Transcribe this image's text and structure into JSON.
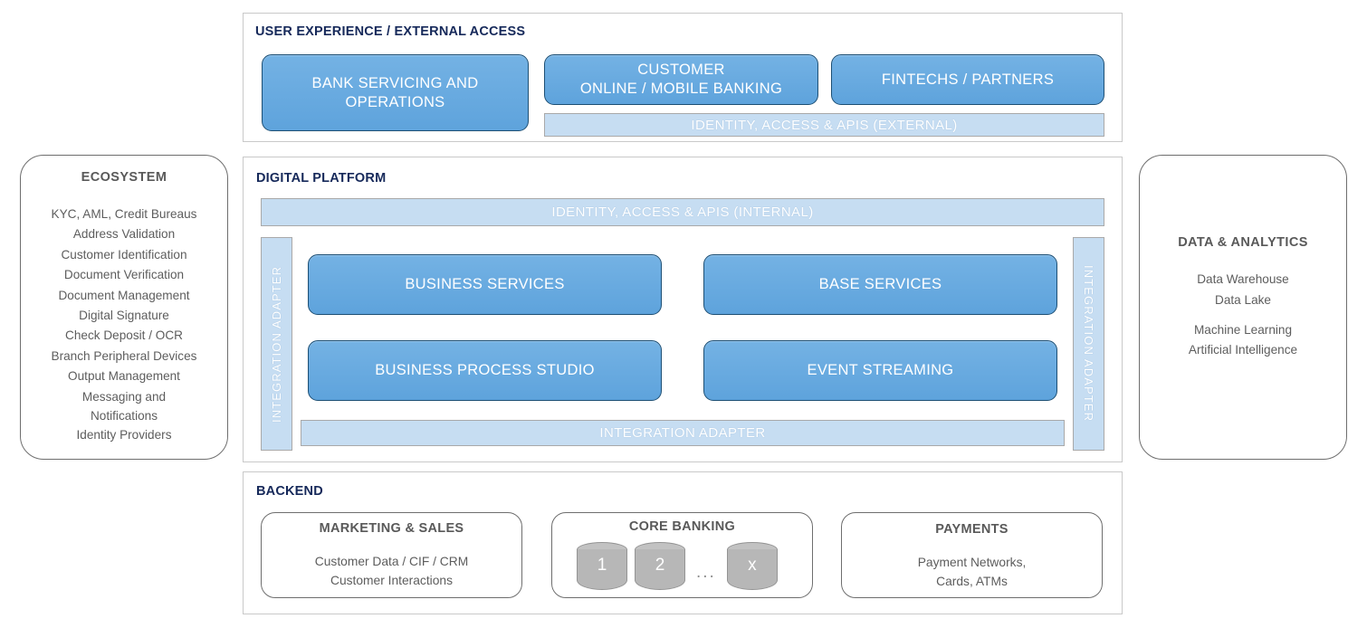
{
  "sections": {
    "ux": {
      "title": "USER EXPERIENCE / EXTERNAL ACCESS",
      "boxes": [
        {
          "label": "BANK SERVICING AND OPERATIONS"
        },
        {
          "label": "CUSTOMER\nONLINE / MOBILE BANKING"
        },
        {
          "label": "FINTECHS / PARTNERS"
        }
      ],
      "band": "IDENTITY, ACCESS & APIS (EXTERNAL)"
    },
    "platform": {
      "title": "DIGITAL PLATFORM",
      "top_band": "IDENTITY, ACCESS & APIS (INTERNAL)",
      "left_adapter": "INTEGRATION ADAPTER",
      "right_adapter": "INTEGRATION ADAPTER",
      "bottom_band": "INTEGRATION ADAPTER",
      "boxes": [
        {
          "label": "BUSINESS SERVICES"
        },
        {
          "label": "BASE SERVICES"
        },
        {
          "label": "BUSINESS PROCESS STUDIO"
        },
        {
          "label": "EVENT STREAMING"
        }
      ]
    },
    "backend": {
      "title": "BACKEND",
      "marketing": {
        "title": "MARKETING & SALES",
        "lines": [
          "Customer Data / CIF / CRM",
          "Customer Interactions"
        ]
      },
      "core_banking": {
        "title": "CORE BANKING",
        "cylinders": [
          "1",
          "2",
          "x"
        ],
        "ellipsis": "..."
      },
      "payments": {
        "title": "PAYMENTS",
        "lines": [
          "Payment Networks,",
          "Cards, ATMs"
        ]
      }
    }
  },
  "ecosystem": {
    "title": "ECOSYSTEM",
    "items": [
      "KYC, AML, Credit Bureaus",
      "Address Validation",
      "Customer Identification",
      "Document Verification",
      "Document Management",
      "Digital Signature",
      "Check Deposit / OCR",
      "Branch Peripheral Devices",
      "Output Management",
      "Messaging and Notifications",
      "Identity Providers"
    ]
  },
  "analytics": {
    "title": "DATA & ANALYTICS",
    "group_one": [
      "Data Warehouse",
      "Data Lake"
    ],
    "group_two": [
      "Machine Learning",
      "Artificial Intelligence"
    ]
  },
  "colors": {
    "accent_blue": "#5ea3dc",
    "blue_border": "#1d4f74",
    "band_blue": "#c6ddf2",
    "title_navy": "#16295a",
    "frame_border": "#c9c9c9",
    "capsule_border": "#6e6e6e",
    "text_gray": "#5d5d5d",
    "cylinder_gray": "#b7b7b7"
  }
}
